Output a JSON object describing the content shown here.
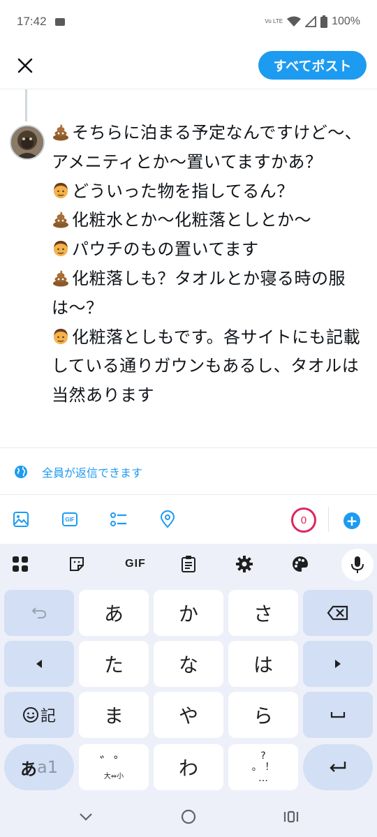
{
  "status_bar": {
    "time": "17:42",
    "network_label": "Vo LTE",
    "battery": "100%"
  },
  "header": {
    "close_icon": "close-icon",
    "post_all_label": "すべてポスト"
  },
  "compose": {
    "lines": [
      {
        "emoji": "poop",
        "text": "そちらに泊まる予定なんですけど〜、"
      },
      {
        "emoji": "",
        "text": "アメニティとか〜置いてますかあ？"
      },
      {
        "emoji": "man",
        "text": "どういった物を指してるん？"
      },
      {
        "emoji": "poop",
        "text": "化粧水とか〜化粧落としとか〜"
      },
      {
        "emoji": "man",
        "text": "パウチのもの置いてます"
      },
      {
        "emoji": "poop",
        "text": "化粧落しも？タオルとか寝る時の服"
      },
      {
        "emoji": "",
        "text": "は〜？"
      },
      {
        "emoji": "man",
        "text": "化粧落としもです。各サイトにも記載"
      },
      {
        "emoji": "",
        "text": "している通りガウンもあるし、タオルは"
      },
      {
        "emoji": "",
        "text": "当然あります"
      }
    ]
  },
  "reply_setting": {
    "icon": "globe-icon",
    "label": "全員が返信できます"
  },
  "toolbar": {
    "icons": [
      "image-icon",
      "gif-icon",
      "poll-icon",
      "location-icon"
    ],
    "gif_label": "GIF",
    "char_counter": "0",
    "add_icon": "plus-icon",
    "accent_color": "#1d9bf0",
    "counter_color": "#e0245e"
  },
  "keyboard": {
    "toolbar": {
      "gif_label": "GIF",
      "icons": [
        "grid-icon",
        "sticker-icon",
        "clipboard-icon",
        "gear-icon",
        "palette-icon",
        "mic-icon"
      ]
    },
    "row1": {
      "undo": "undo-icon",
      "k1": "あ",
      "k2": "か",
      "k3": "さ",
      "backspace": "backspace-icon"
    },
    "row2": {
      "left": "left-arrow-icon",
      "k1": "た",
      "k2": "な",
      "k3": "は",
      "right": "right-arrow-icon"
    },
    "row3": {
      "emoji_label": "記",
      "k1": "ま",
      "k2": "や",
      "k3": "ら",
      "space": "space-icon"
    },
    "row4": {
      "mode_kana": "あ",
      "mode_alnum": "a1",
      "dakuten_top": "゛゜",
      "dakuten_bottom": "大⇔小",
      "k2": "わ",
      "punct_top": "?",
      "punct_mid": "。 ！",
      "punct_bottom": "…",
      "enter": "enter-icon"
    }
  },
  "nav_bar": {
    "icons": [
      "back-chevron-icon",
      "home-circle-icon",
      "recents-icon"
    ]
  }
}
